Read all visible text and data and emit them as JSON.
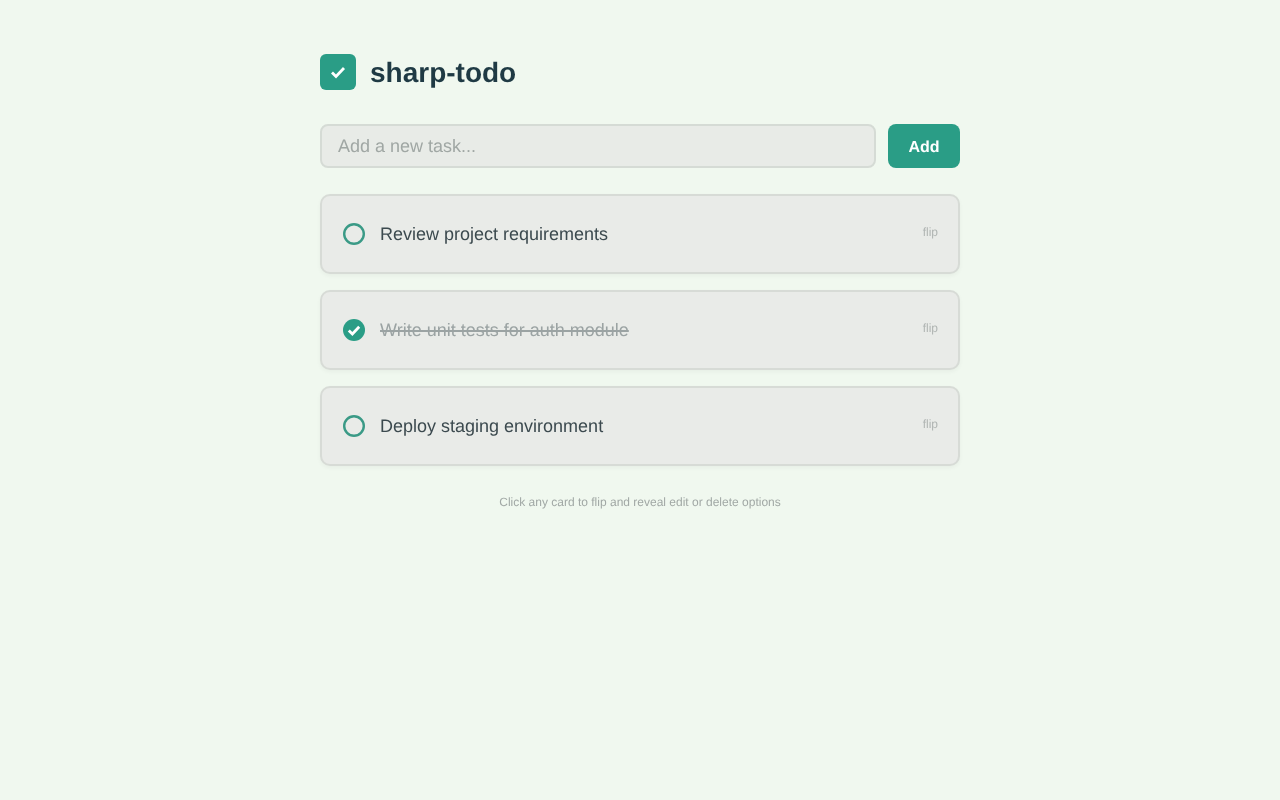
{
  "app": {
    "title": "sharp-todo"
  },
  "new_task": {
    "placeholder": "Add a new task...",
    "button": "Add"
  },
  "tasks": [
    {
      "text": "Review project requirements",
      "checked": false,
      "hint": "flip"
    },
    {
      "text": "Write unit tests for auth module",
      "checked": true,
      "hint": "flip"
    },
    {
      "text": "Deploy staging environment",
      "checked": false,
      "hint": "flip"
    }
  ],
  "footer": "Click any card to flip and reveal edit or delete options"
}
